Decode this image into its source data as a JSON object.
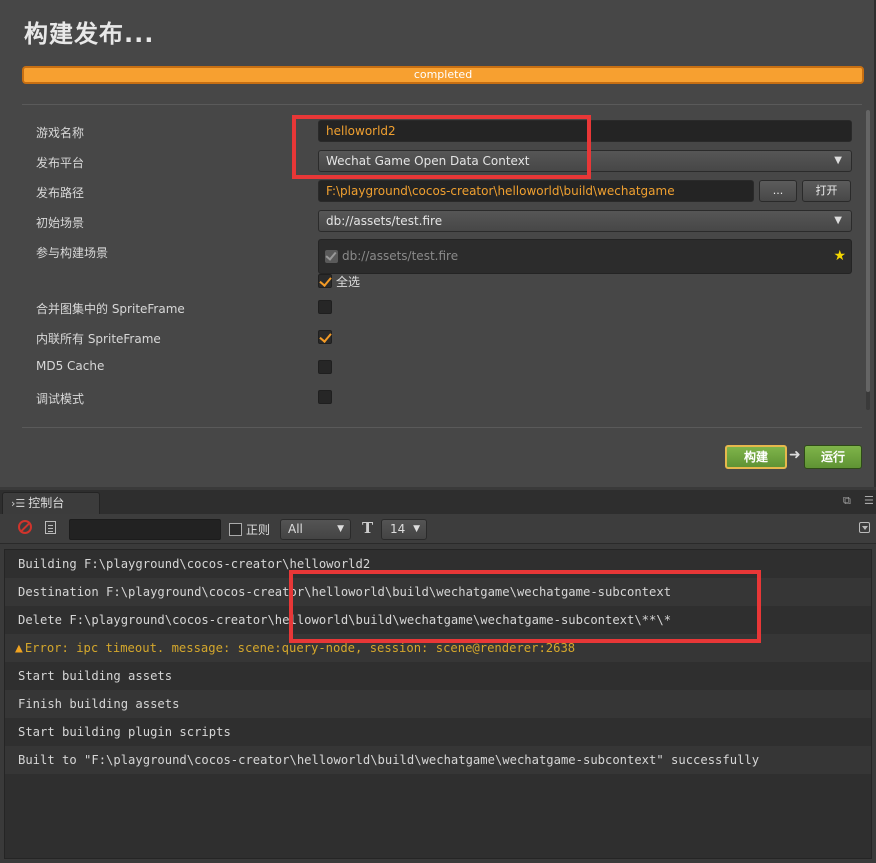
{
  "build_panel": {
    "title": "构建发布...",
    "progress": {
      "label": "completed",
      "value": 1.0
    },
    "fields": {
      "game_name": {
        "label": "游戏名称",
        "value": "helloworld2"
      },
      "platform": {
        "label": "发布平台",
        "value": "Wechat Game Open Data Context"
      },
      "build_path": {
        "label": "发布路径",
        "value": "F:\\playground\\cocos-creator\\helloworld\\build\\wechatgame",
        "browse_label": "...",
        "open_label": "打开"
      },
      "start_scene": {
        "label": "初始场景",
        "value": "db://assets/test.fire"
      },
      "included_scenes": {
        "label": "参与构建场景",
        "items": [
          "db://assets/test.fire"
        ],
        "select_all_label": "全选"
      },
      "merge_atlas": {
        "label": "合并图集中的 SpriteFrame",
        "checked": false
      },
      "inline_spriteframe": {
        "label": "内联所有 SpriteFrame",
        "checked": true
      },
      "md5_cache": {
        "label": "MD5 Cache",
        "checked": false
      },
      "debug_mode": {
        "label": "调试模式",
        "checked": false
      }
    },
    "buttons": {
      "build": "构建",
      "run": "运行"
    },
    "icons": {
      "star": "star-icon",
      "arrow": "arrow-right-icon"
    }
  },
  "console": {
    "tab_label": "控制台",
    "toolbar": {
      "filter_value": "",
      "regex_label": "正则",
      "level_value": "All",
      "font_icon": "T",
      "font_size_value": "14"
    },
    "logs": [
      {
        "type": "info",
        "text": "Building F:\\playground\\cocos-creator\\helloworld2"
      },
      {
        "type": "info",
        "text": "Destination F:\\playground\\cocos-creator\\helloworld\\build\\wechatgame\\wechatgame-subcontext"
      },
      {
        "type": "info",
        "text": "Delete F:\\playground\\cocos-creator\\helloworld\\build\\wechatgame\\wechatgame-subcontext\\**\\*"
      },
      {
        "type": "warn",
        "text": "Error: ipc timeout. message: scene:query-node, session: scene@renderer:2638"
      },
      {
        "type": "info",
        "text": "Start building assets"
      },
      {
        "type": "info",
        "text": "Finish building assets"
      },
      {
        "type": "info",
        "text": "Start building plugin scripts"
      },
      {
        "type": "info",
        "text": "Built to \"F:\\playground\\cocos-creator\\helloworld\\build\\wechatgame\\wechatgame-subcontext\" successfully"
      }
    ]
  },
  "colors": {
    "accent": "#f39a2c",
    "annotation": "#e83737",
    "run_green": "#6aa33c",
    "warning": "#d4a72c"
  }
}
